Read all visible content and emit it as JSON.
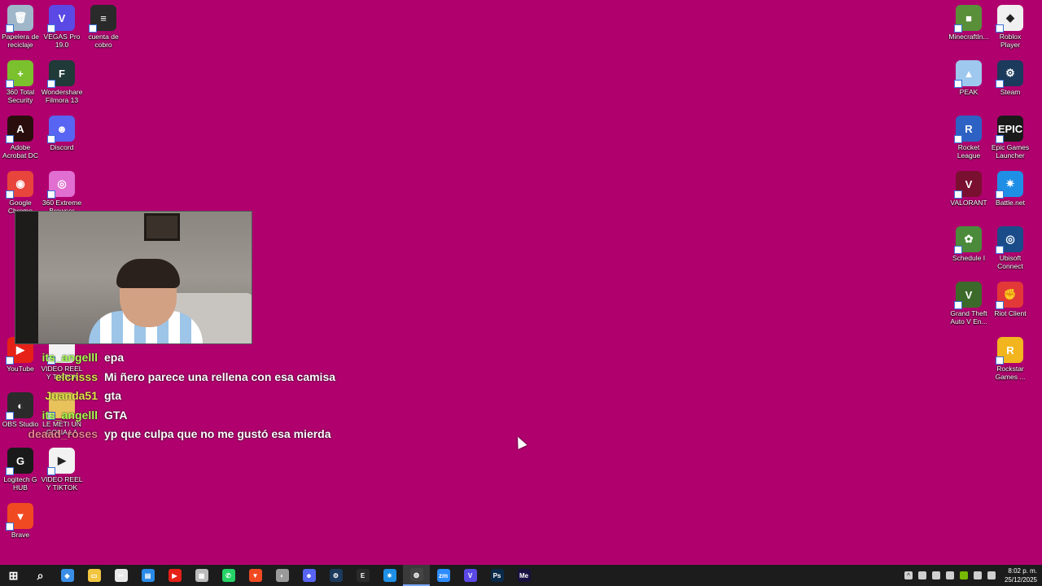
{
  "colors": {
    "desktop_background": "#b0006e",
    "taskbar_background": "#1c1c1c"
  },
  "desktop_icons_left": [
    {
      "label": "Papelera de reciclaje",
      "icon": "recycle-bin-icon",
      "color": "#9fb7c9",
      "glyph": "🗑"
    },
    {
      "label": "VEGAS Pro 19.0",
      "icon": "vegas-pro-icon",
      "color": "#5b49e6",
      "glyph": "V"
    },
    {
      "label": "cuenta de cobro",
      "icon": "document-icon",
      "color": "#2a2a2a",
      "glyph": "≡"
    },
    {
      "label": "360 Total Security",
      "icon": "360-security-icon",
      "color": "#7ac12d",
      "glyph": "+"
    },
    {
      "label": "Wondershare Filmora 13",
      "icon": "filmora-icon",
      "color": "#1f3a38",
      "glyph": "F"
    },
    {
      "label": "Adobe Acrobat DC",
      "icon": "acrobat-icon",
      "color": "#2a0e0e",
      "glyph": "A"
    },
    {
      "label": "Discord",
      "icon": "discord-icon",
      "color": "#5865f2",
      "glyph": "☻"
    },
    {
      "label": "Google Chrome",
      "icon": "chrome-icon",
      "color": "#e8453c",
      "glyph": "◉"
    },
    {
      "label": "360 Extreme Browser",
      "icon": "360-browser-icon",
      "color": "#e06fd1",
      "glyph": "◎"
    },
    {
      "label": "YouTube",
      "icon": "youtube-icon",
      "color": "#e62117",
      "glyph": "▶"
    },
    {
      "label": "VIDEO REEL Y TIKTOK",
      "icon": "video-file-icon",
      "color": "#f2f2f2",
      "glyph": ""
    },
    {
      "label": "OBS Studio",
      "icon": "obs-icon",
      "color": "#2b2b2b",
      "glyph": "◐"
    },
    {
      "label": "LE METI UN GOLIA LA",
      "icon": "folder-icon",
      "color": "#e8c25a",
      "glyph": ""
    },
    {
      "label": "Logitech G HUB",
      "icon": "logitech-icon",
      "color": "#1a1a1a",
      "glyph": "G"
    },
    {
      "label": "VIDEO REEL Y TIKTOK",
      "icon": "video-file-icon",
      "color": "#f2f2f2",
      "glyph": "▶"
    },
    {
      "label": "Brave",
      "icon": "brave-icon",
      "color": "#f04a22",
      "glyph": "▼"
    }
  ],
  "desktop_icons_right": [
    {
      "label": "MinecraftIn...",
      "icon": "minecraft-icon",
      "color": "#5a8f3a",
      "glyph": "■"
    },
    {
      "label": "Roblox Player",
      "icon": "roblox-icon",
      "color": "#f0f0f0",
      "glyph": "◆"
    },
    {
      "label": "PEAK",
      "icon": "peak-icon",
      "color": "#9ec8ee",
      "glyph": "▲"
    },
    {
      "label": "Steam",
      "icon": "steam-icon",
      "color": "#1b3a5c",
      "glyph": "⚙"
    },
    {
      "label": "Rocket League",
      "icon": "rocket-league-icon",
      "color": "#2d62c4",
      "glyph": "R"
    },
    {
      "label": "Epic Games Launcher",
      "icon": "epic-games-icon",
      "color": "#1a1a1a",
      "glyph": "EPIC"
    },
    {
      "label": "VALORANT",
      "icon": "valorant-icon",
      "color": "#7a1030",
      "glyph": "V"
    },
    {
      "label": "Battle.net",
      "icon": "battlenet-icon",
      "color": "#1f8fe6",
      "glyph": "✷"
    },
    {
      "label": "Schedule I",
      "icon": "schedule-icon",
      "color": "#4a8a3a",
      "glyph": "✿"
    },
    {
      "label": "Ubisoft Connect",
      "icon": "ubisoft-icon",
      "color": "#1a4c8a",
      "glyph": "◎"
    },
    {
      "label": "Grand Theft Auto V En...",
      "icon": "gta-icon",
      "color": "#3c6a2a",
      "glyph": "V"
    },
    {
      "label": "Riot Client",
      "icon": "riot-icon",
      "color": "#e23838",
      "glyph": "✊"
    },
    {
      "label": "Rockstar Games ...",
      "icon": "rockstar-icon",
      "color": "#f2b51e",
      "glyph": "R"
    }
  ],
  "chat": [
    {
      "user": "its_angelll",
      "user_color": "#a6ff4d",
      "message": "epa"
    },
    {
      "user": "elcrisss",
      "user_color": "#d6e84a",
      "message": "Mi ñero parece una rellena con esa camisa"
    },
    {
      "user": "Juanda51",
      "user_color": "#e2e84a",
      "message": "gta"
    },
    {
      "user": "its_angelll",
      "user_color": "#a6ff4d",
      "message": "GTA"
    },
    {
      "user": "deaad_roses",
      "user_color": "#e5838f",
      "message": "yp que culpa que no me gustó esa mierda"
    }
  ],
  "taskbar": {
    "items": [
      {
        "icon": "start-icon",
        "color": "#ffffff",
        "glyph": "⊞"
      },
      {
        "icon": "search-icon",
        "color": "#ffffff",
        "glyph": "⌕"
      },
      {
        "icon": "copilot-icon",
        "color": "#3a8ee6",
        "glyph": "◆"
      },
      {
        "icon": "file-explorer-icon",
        "color": "#f2c641",
        "glyph": "▭"
      },
      {
        "icon": "capcut-icon",
        "color": "#e8e8e8",
        "glyph": "✂"
      },
      {
        "icon": "store-icon",
        "color": "#2a8ae6",
        "glyph": "▤"
      },
      {
        "icon": "youtube-icon",
        "color": "#e62117",
        "glyph": "▶"
      },
      {
        "icon": "clipboard-icon",
        "color": "#bcbcbc",
        "glyph": "▦"
      },
      {
        "icon": "whatsapp-icon",
        "color": "#25d366",
        "glyph": "✆"
      },
      {
        "icon": "brave-icon",
        "color": "#f04a22",
        "glyph": "▼"
      },
      {
        "icon": "obs-icon",
        "color": "#9a9a9a",
        "glyph": "◐"
      },
      {
        "icon": "discord-icon",
        "color": "#5865f2",
        "glyph": "☻"
      },
      {
        "icon": "steam-icon",
        "color": "#1b3a5c",
        "glyph": "⚙"
      },
      {
        "icon": "epic-games-icon",
        "color": "#2a2a2a",
        "glyph": "E"
      },
      {
        "icon": "battlenet-icon",
        "color": "#1f8fe6",
        "glyph": "✷"
      },
      {
        "icon": "streamlabs-icon",
        "color": "#444444",
        "glyph": "◍"
      },
      {
        "icon": "zoom-icon",
        "color": "#2d8cff",
        "glyph": "zm"
      },
      {
        "icon": "vegas-pro-icon",
        "color": "#5b49e6",
        "glyph": "V"
      },
      {
        "icon": "photoshop-icon",
        "color": "#0a2a4a",
        "glyph": "Ps"
      },
      {
        "icon": "media-encoder-icon",
        "color": "#1a1040",
        "glyph": "Me"
      }
    ],
    "clock_time": "8:02 p. m.",
    "clock_date": "25/12/2025"
  }
}
